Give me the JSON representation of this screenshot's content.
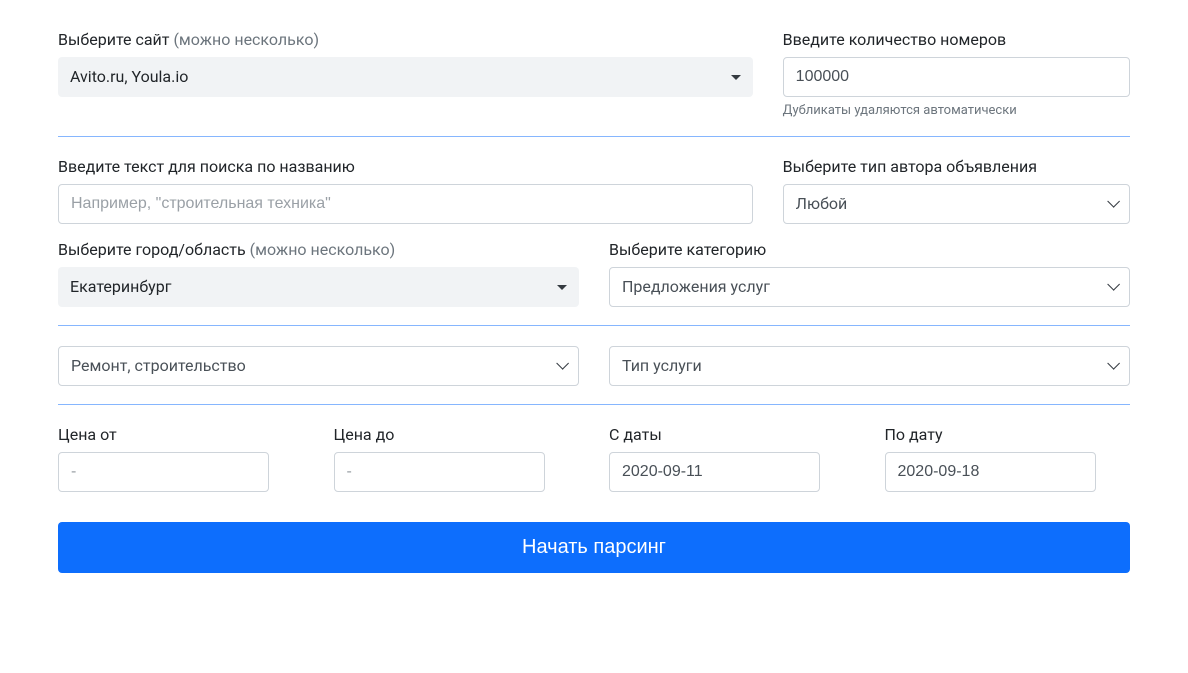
{
  "site": {
    "label": "Выберите сайт",
    "hint": "(можно несколько)",
    "value": "Avito.ru, Youla.io"
  },
  "quantity": {
    "label": "Введите количество номеров",
    "value": "100000",
    "help": "Дубликаты удаляются автоматически"
  },
  "search_text": {
    "label": "Введите текст для поиска по названию",
    "placeholder": "Например, \"строительная техника\""
  },
  "author_type": {
    "label": "Выберите тип автора объявления",
    "value": "Любой"
  },
  "city": {
    "label": "Выберите город/область",
    "hint": "(можно несколько)",
    "value": "Екатеринбург"
  },
  "category": {
    "label": "Выберите категорию",
    "value": "Предложения услуг"
  },
  "subcategory": {
    "value": "Ремонт, строительство"
  },
  "service_type": {
    "placeholder": "Тип услуги"
  },
  "price_from": {
    "label": "Цена от",
    "placeholder": "-"
  },
  "price_to": {
    "label": "Цена до",
    "placeholder": "-"
  },
  "date_from": {
    "label": "С даты",
    "value": "2020-09-11"
  },
  "date_to": {
    "label": "По дату",
    "value": "2020-09-18"
  },
  "submit": {
    "label": "Начать парсинг"
  }
}
